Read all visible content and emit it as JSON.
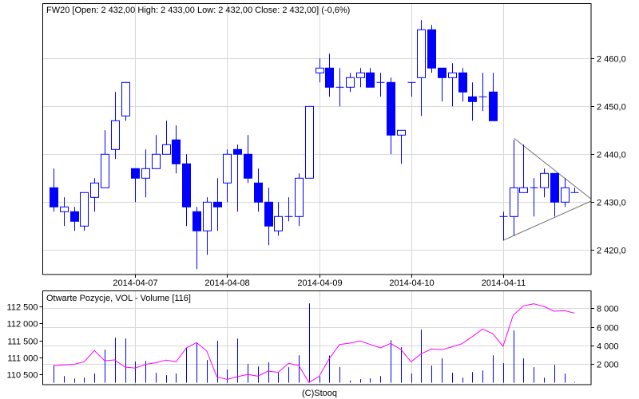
{
  "chart_data": [
    {
      "type": "candlestick",
      "title": "FW20 [Open: 2 432,00  High: 2 433,00  Low: 2 432,00  Close: 2 432,00] (-0,6%)",
      "ylim": [
        2414,
        2470
      ],
      "yticks": [
        2420,
        2430,
        2440,
        2450,
        2460
      ],
      "ytick_labels": [
        "2 420,0",
        "2 430,0",
        "2 440,0",
        "2 450,0",
        "2 460,0"
      ],
      "date_labels": [
        {
          "label": "2014-04-07",
          "index": 8
        },
        {
          "label": "2014-04-08",
          "index": 17
        },
        {
          "label": "2014-04-09",
          "index": 26
        },
        {
          "label": "2014-04-10",
          "index": 35
        },
        {
          "label": "2014-04-11",
          "index": 44
        }
      ],
      "grid": true,
      "colors": {
        "candle": "#0000ff",
        "grid": "#d8d8d8",
        "trendline": "#707070"
      },
      "ohlc": [
        [
          2433,
          2437,
          2428,
          2429
        ],
        [
          2428,
          2431,
          2425,
          2429
        ],
        [
          2428,
          2429,
          2424,
          2426
        ],
        [
          2425,
          2432,
          2424,
          2432
        ],
        [
          2431,
          2435,
          2428,
          2434
        ],
        [
          2433,
          2445,
          2433,
          2440
        ],
        [
          2441,
          2453,
          2439,
          2447
        ],
        [
          2448,
          2455,
          2447,
          2455
        ],
        [
          2437,
          2437,
          2430,
          2435
        ],
        [
          2435,
          2441,
          2431,
          2437
        ],
        [
          2437,
          2444,
          2437,
          2440
        ],
        [
          2440,
          2447,
          2440,
          2442
        ],
        [
          2443,
          2446,
          2436,
          2438
        ],
        [
          2438,
          2440,
          2425,
          2429
        ],
        [
          2428,
          2429,
          2416,
          2424
        ],
        [
          2424,
          2431,
          2419,
          2430
        ],
        [
          2430,
          2435,
          2424,
          2429
        ],
        [
          2434,
          2441,
          2430,
          2440
        ],
        [
          2441,
          2442,
          2428,
          2440
        ],
        [
          2440,
          2444,
          2434,
          2435
        ],
        [
          2434,
          2437,
          2428,
          2430
        ],
        [
          2430,
          2433,
          2421,
          2425
        ],
        [
          2424,
          2430,
          2423,
          2427
        ],
        [
          2427,
          2431,
          2426,
          2427
        ],
        [
          2427,
          2436,
          2425,
          2435
        ],
        [
          2435,
          2450,
          2435,
          2450
        ],
        [
          2457,
          2460,
          2455,
          2458
        ],
        [
          2458,
          2461,
          2452,
          2454
        ],
        [
          2454,
          2458,
          2450,
          2454
        ],
        [
          2454,
          2457,
          2453,
          2456
        ],
        [
          2456,
          2458,
          2454,
          2457
        ],
        [
          2457,
          2458,
          2454,
          2454
        ],
        [
          2455,
          2457,
          2452,
          2455
        ],
        [
          2455,
          2456,
          2440,
          2444
        ],
        [
          2444,
          2445,
          2438,
          2445
        ],
        [
          2455,
          2455,
          2452,
          2455
        ],
        [
          2456,
          2468,
          2448,
          2466
        ],
        [
          2466,
          2467,
          2457,
          2458
        ],
        [
          2458,
          2458,
          2451,
          2456
        ],
        [
          2456,
          2459,
          2450,
          2457
        ],
        [
          2457,
          2458,
          2451,
          2453
        ],
        [
          2452,
          2455,
          2447,
          2451
        ],
        [
          2452,
          2457,
          2449,
          2452
        ],
        [
          2453,
          2457,
          2447,
          2447
        ],
        [
          2427,
          2428,
          2422,
          2427
        ],
        [
          2427,
          2443,
          2423,
          2433
        ],
        [
          2432,
          2442,
          2432,
          2433
        ],
        [
          2433,
          2435,
          2427,
          2433
        ],
        [
          2433,
          2437,
          2431,
          2436
        ],
        [
          2436,
          2436,
          2427,
          2430
        ],
        [
          2430,
          2435,
          2429,
          2433
        ],
        [
          2432,
          2433,
          2432,
          2432
        ]
      ],
      "trendlines": [
        {
          "from": {
            "index": 44,
            "price": 2422
          },
          "to": {
            "index": 52.6,
            "price": 2430.2
          }
        },
        {
          "from": {
            "index": 45.1,
            "price": 2443.3
          },
          "to": {
            "index": 52.6,
            "price": 2430.7
          }
        }
      ]
    },
    {
      "type": "bar+line",
      "title": "Otwarte Pozycje, VOL - Volume [116]",
      "left_axis": {
        "ylim": [
          110250,
          112950
        ],
        "ticks": [
          110500,
          111000,
          111500,
          112000,
          112500
        ],
        "tick_labels": [
          "110 500",
          "111 000",
          "111 500",
          "112 000",
          "112 500"
        ]
      },
      "right_axis": {
        "ylim": [
          0,
          9700
        ],
        "ticks": [
          2000,
          4000,
          6000,
          8000
        ],
        "tick_labels": [
          "2 000",
          "4 000",
          "6 000",
          "8 000"
        ]
      },
      "series": [
        {
          "name": "Volume",
          "type": "bar",
          "axis": "right",
          "color": "#0000ff",
          "values": [
            1890,
            710,
            430,
            540,
            970,
            3540,
            4830,
            4740,
            2260,
            2340,
            1060,
            800,
            970,
            3690,
            4290,
            2430,
            4490,
            1400,
            4740,
            2000,
            1740,
            2170,
            1060,
            1660,
            2940,
            8510,
            660,
            2910,
            1660,
            230,
            370,
            460,
            710,
            4570,
            3800,
            970,
            5690,
            1830,
            2600,
            1060,
            540,
            1140,
            1310,
            2940,
            2090,
            5600,
            2600,
            1660,
            540,
            1910,
            970,
            60
          ]
        },
        {
          "name": "Otwarte Pozycje",
          "type": "line",
          "axis": "left",
          "color": "#ff00ff",
          "values": [
            110758,
            110781,
            110797,
            110875,
            111203,
            110906,
            110930,
            110719,
            110688,
            110797,
            110844,
            110922,
            110875,
            111281,
            111438,
            111188,
            110430,
            110360,
            110438,
            110500,
            110453,
            110602,
            110563,
            110828,
            110766,
            110266,
            110445,
            110969,
            111383,
            111422,
            111484,
            111383,
            111281,
            111414,
            111234,
            110875,
            111109,
            111250,
            111227,
            111313,
            111406,
            111617,
            111836,
            111695,
            111328,
            112242,
            112516,
            112578,
            112500,
            112359,
            112375,
            112305
          ]
        }
      ]
    }
  ],
  "footer": {
    "copyright": "(C)Stooq"
  }
}
